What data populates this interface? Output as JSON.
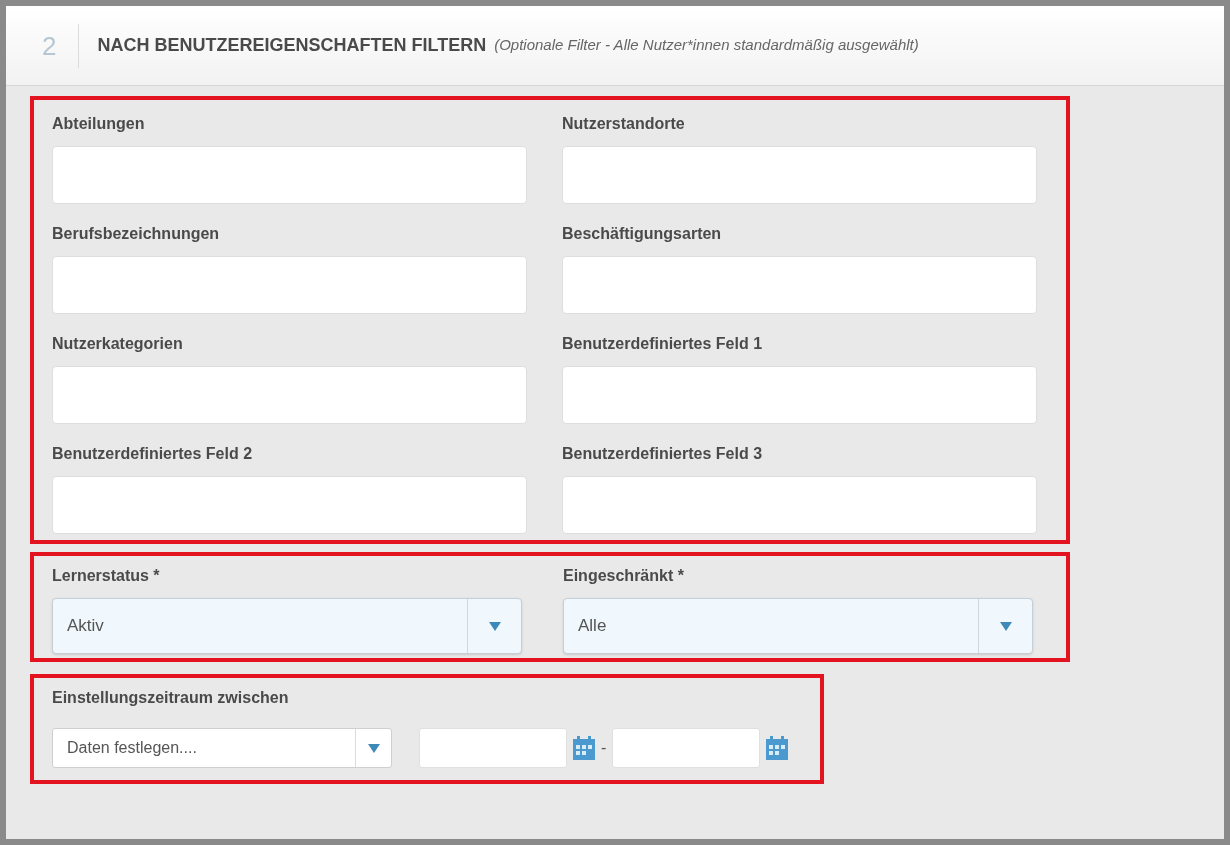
{
  "header": {
    "step": "2",
    "title": "NACH BENUTZEREIGENSCHAFTEN FILTERN",
    "subtitle": "(Optionale Filter - Alle Nutzer*innen standardmäßig ausgewählt)"
  },
  "text_fields": [
    {
      "label": "Abteilungen"
    },
    {
      "label": "Nutzerstandorte"
    },
    {
      "label": "Berufsbezeichnungen"
    },
    {
      "label": "Beschäftigungsarten"
    },
    {
      "label": "Nutzerkategorien"
    },
    {
      "label": "Benutzerdefiniertes Feld 1"
    },
    {
      "label": "Benutzerdefiniertes Feld 2"
    },
    {
      "label": "Benutzerdefiniertes Feld 3"
    }
  ],
  "selects": [
    {
      "label": "Lernerstatus *",
      "value": "Aktiv"
    },
    {
      "label": "Eingeschränkt *",
      "value": "Alle"
    }
  ],
  "date_range": {
    "label": "Einstellungszeitraum zwischen",
    "preset": "Daten festlegen....",
    "separator": "-"
  }
}
